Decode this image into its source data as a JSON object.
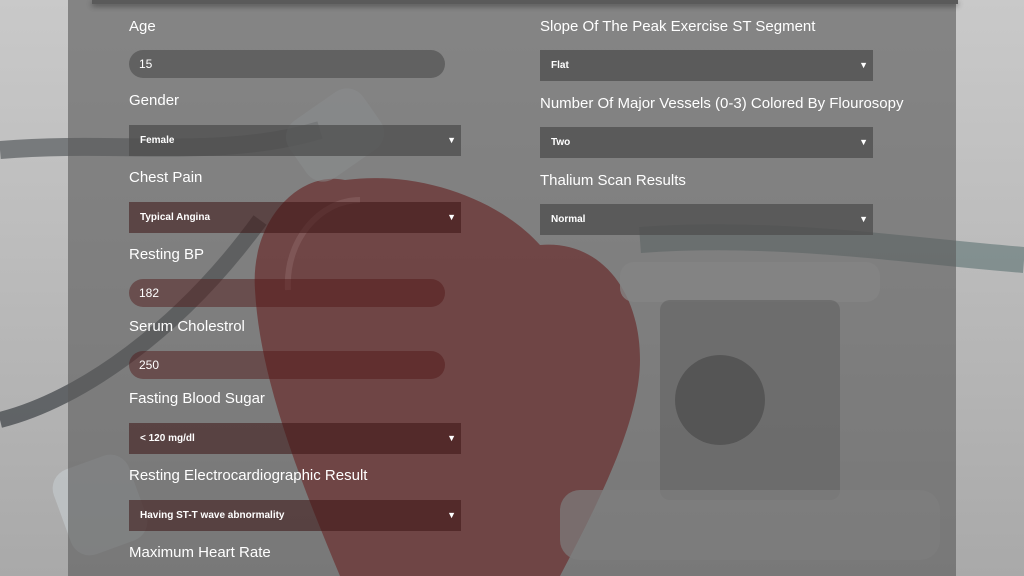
{
  "form": {
    "age": {
      "label": "Age",
      "value": "15"
    },
    "gender": {
      "label": "Gender",
      "selected": "Female"
    },
    "chest_pain": {
      "label": "Chest Pain",
      "selected": "Typical Angina"
    },
    "resting_bp": {
      "label": "Resting BP",
      "value": "182"
    },
    "serum_cholestrol": {
      "label": "Serum Cholestrol",
      "value": "250"
    },
    "fasting_blood_sugar": {
      "label": "Fasting Blood Sugar",
      "selected": "< 120 mg/dl"
    },
    "resting_ecg": {
      "label": "Resting Electrocardiographic Result",
      "selected": "Having ST-T wave abnormality"
    },
    "max_heart_rate": {
      "label": "Maximum Heart Rate"
    },
    "slope": {
      "label": "Slope Of The Peak Exercise ST Segment",
      "selected": "Flat"
    },
    "major_vessels": {
      "label": "Number Of Major Vessels (0-3) Colored By Flourosopy",
      "selected": "Two"
    },
    "thalium": {
      "label": "Thalium Scan Results",
      "selected": "Normal"
    }
  },
  "icons": {
    "dropdown": "caret-down-icon"
  },
  "colors": {
    "panel": "#5a5a5a",
    "heart": "#9e1a1a",
    "text": "#ffffff"
  }
}
